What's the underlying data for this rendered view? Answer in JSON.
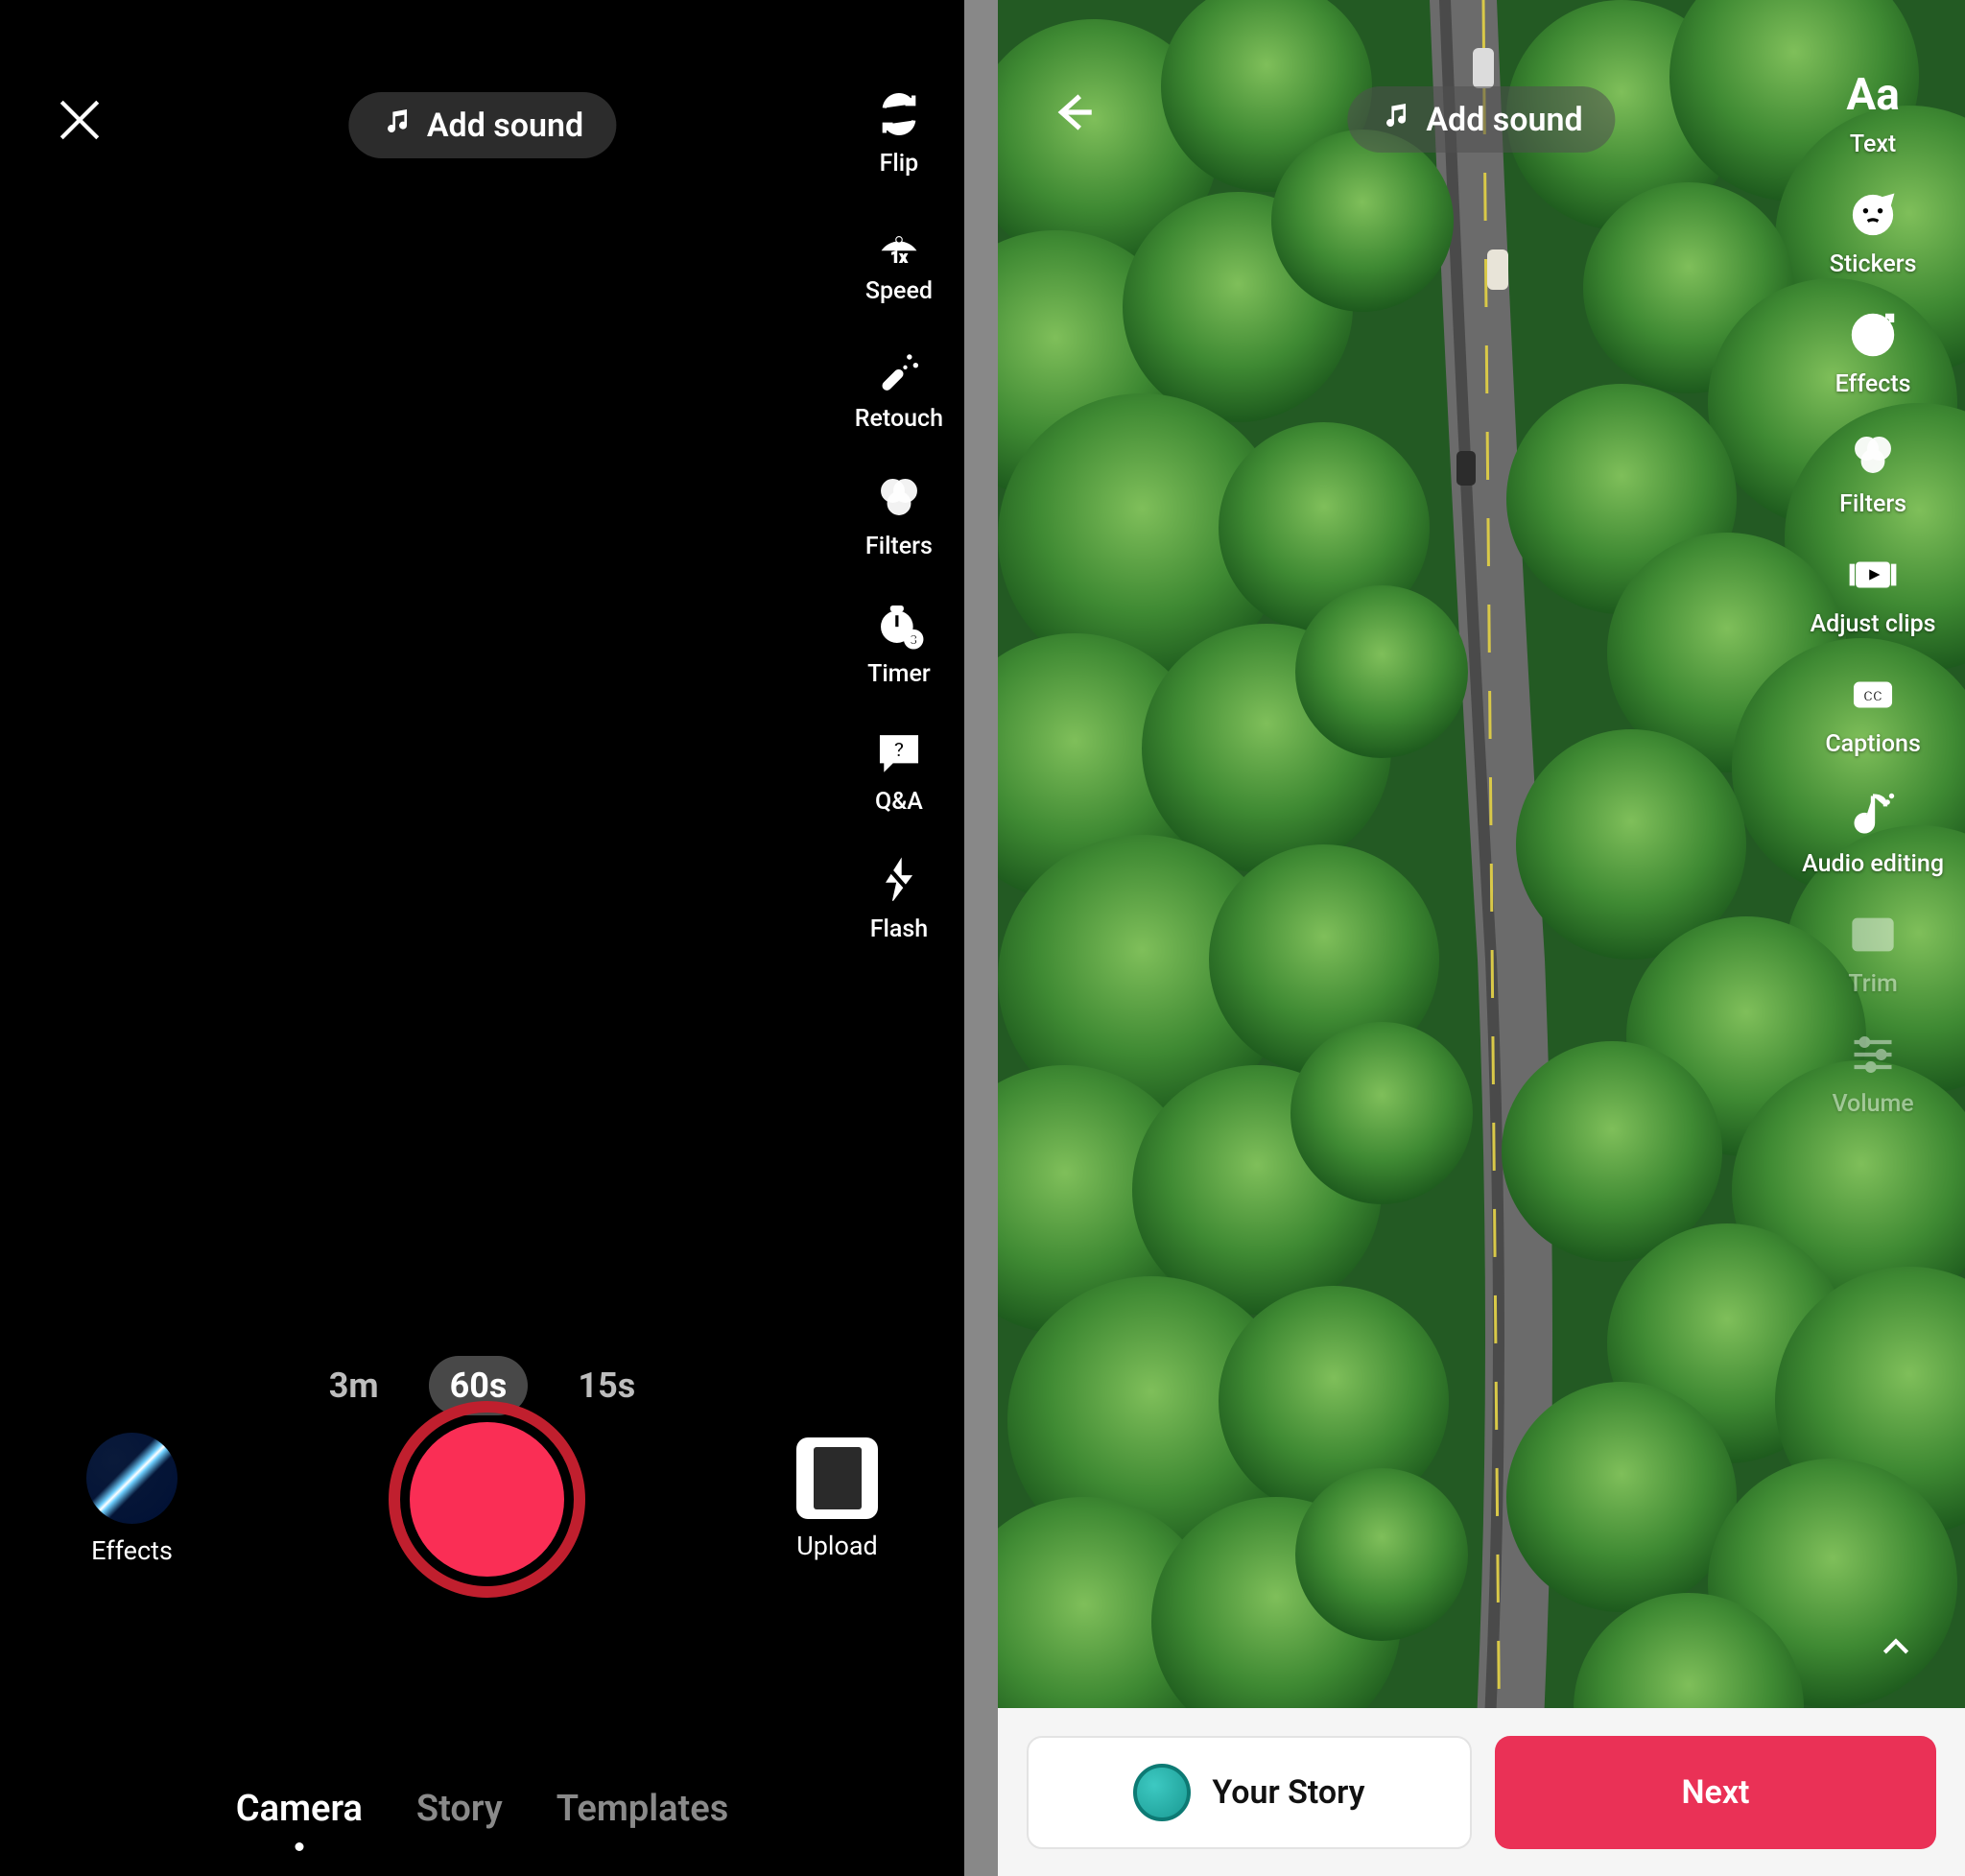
{
  "left": {
    "add_sound": "Add sound",
    "tools": [
      {
        "id": "flip",
        "label": "Flip"
      },
      {
        "id": "speed",
        "label": "Speed"
      },
      {
        "id": "retouch",
        "label": "Retouch"
      },
      {
        "id": "filters",
        "label": "Filters"
      },
      {
        "id": "timer",
        "label": "Timer"
      },
      {
        "id": "qa",
        "label": "Q&A"
      },
      {
        "id": "flash",
        "label": "Flash"
      }
    ],
    "durations": [
      "3m",
      "60s",
      "15s"
    ],
    "duration_active": "60s",
    "effects_label": "Effects",
    "upload_label": "Upload",
    "modes": [
      "Camera",
      "Story",
      "Templates"
    ],
    "mode_active": "Camera"
  },
  "right": {
    "add_sound": "Add sound",
    "tools": [
      {
        "id": "text",
        "label": "Text"
      },
      {
        "id": "stickers",
        "label": "Stickers"
      },
      {
        "id": "effects",
        "label": "Effects"
      },
      {
        "id": "filters",
        "label": "Filters"
      },
      {
        "id": "adjust",
        "label": "Adjust clips"
      },
      {
        "id": "captions",
        "label": "Captions"
      },
      {
        "id": "audio",
        "label": "Audio editing"
      },
      {
        "id": "trim",
        "label": "Trim"
      },
      {
        "id": "volume",
        "label": "Volume"
      }
    ],
    "your_story": "Your Story",
    "next": "Next"
  }
}
